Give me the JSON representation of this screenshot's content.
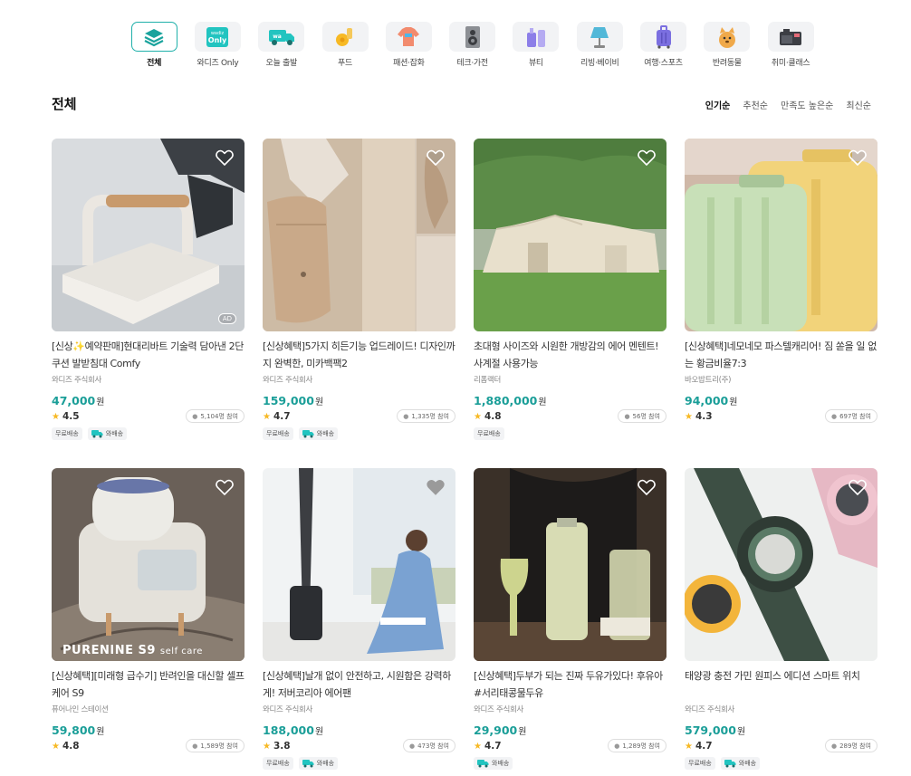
{
  "categories": [
    {
      "label": "전체",
      "icon": "layers-icon",
      "active": true
    },
    {
      "label": "와디즈 Only",
      "icon": "wadiz-only-icon",
      "badge": "wadiz Only",
      "active": false
    },
    {
      "label": "오늘 출발",
      "icon": "delivery-truck-icon",
      "badge": "wa",
      "active": false
    },
    {
      "label": "푸드",
      "icon": "food-icon",
      "active": false
    },
    {
      "label": "패션·잡화",
      "icon": "fashion-icon",
      "active": false
    },
    {
      "label": "테크·가전",
      "icon": "speaker-icon",
      "active": false
    },
    {
      "label": "뷰티",
      "icon": "beauty-icon",
      "active": false
    },
    {
      "label": "리빙·베이비",
      "icon": "lamp-icon",
      "active": false
    },
    {
      "label": "여행·스포츠",
      "icon": "suitcase-icon",
      "active": false
    },
    {
      "label": "반려동물",
      "icon": "pet-icon",
      "active": false
    },
    {
      "label": "취미·클래스",
      "icon": "camera-icon",
      "active": false
    }
  ],
  "section_title": "전체",
  "sort_options": [
    {
      "label": "인기순",
      "active": true
    },
    {
      "label": "추천순",
      "active": false
    },
    {
      "label": "만족도 높은순",
      "active": false
    },
    {
      "label": "최신순",
      "active": false
    }
  ],
  "products": [
    {
      "title": "[신상✨예약판매]현대리바트 기술력 담아낸 2단 쿠션 발받침대 Comfy",
      "seller": "와디즈 주식회사",
      "price": "47,000",
      "won": "원",
      "rating": "4.5",
      "joined": "5,104명 참여",
      "ad": "AD",
      "tags": [
        "무료배송",
        "와배송"
      ],
      "image": "footstool",
      "heart_style": "outline"
    },
    {
      "title": "[신상혜택]5가지 히든기능 업드레이드! 디자인까지 완벽한, 미카백팩2",
      "seller": "와디즈 주식회사",
      "price": "159,000",
      "won": "원",
      "rating": "4.7",
      "joined": "1,335명 참여",
      "tags": [
        "무료배송",
        "와배송"
      ],
      "image": "backpack",
      "heart_style": "outline"
    },
    {
      "title": "초대형 사이즈와 시원한 개방감의 에어 멘텐트! 사계절 사용가능",
      "seller": "리폼랙터",
      "price": "1,880,000",
      "won": "원",
      "rating": "4.8",
      "joined": "56명 참여",
      "tags": [
        "무료배송"
      ],
      "image": "tent",
      "heart_style": "outline"
    },
    {
      "title": "[신상혜택]네모네모 파스텔캐리어! 짐 쏟을 일 없는 황금비율7:3",
      "seller": "바오밥트리(주)",
      "price": "94,000",
      "won": "원",
      "rating": "4.3",
      "joined": "697명 참여",
      "tags": [],
      "image": "suitcase",
      "heart_style": "outline"
    },
    {
      "title": "[신상혜택][미래형 급수기] 반려인을 대신할 셀프케어 S9",
      "seller": "퓨어나인 스테이션",
      "price": "59,800",
      "won": "원",
      "rating": "4.8",
      "joined": "1,589명 참여",
      "overlay_brand": "PURENINE S9",
      "overlay_sub": "self care",
      "tags": [],
      "image": "petfeeder",
      "heart_style": "outline"
    },
    {
      "title": "[신상혜택]날개 없이 안전하고, 시원함은 강력하게! 저버코리아 에어팬",
      "seller": "와디즈 주식회사",
      "price": "188,000",
      "won": "원",
      "rating": "3.8",
      "joined": "473명 참여",
      "tags": [
        "무료배송",
        "와배송"
      ],
      "image": "fan",
      "heart_style": "filled"
    },
    {
      "title": "[신상혜택]두부가 되는 진짜 두유가있다! 후유아 #서리태콩물두유",
      "seller": "와디즈 주식회사",
      "price": "29,900",
      "won": "원",
      "rating": "4.7",
      "joined": "1,289명 참여",
      "tags": [
        "와배송"
      ],
      "image": "soymilk",
      "heart_style": "outline"
    },
    {
      "title": "태양광 충전 가민 원피스 에디션 스마트 위치",
      "seller": "와디즈 주식회사",
      "price": "579,000",
      "won": "원",
      "rating": "4.7",
      "joined": "289명 참여",
      "tags": [
        "무료배송",
        "와배송"
      ],
      "image": "watch",
      "heart_style": "outline"
    }
  ],
  "colors": {
    "accent": "#1fb0aa",
    "price": "#1a9e98",
    "star": "#f7b924"
  }
}
